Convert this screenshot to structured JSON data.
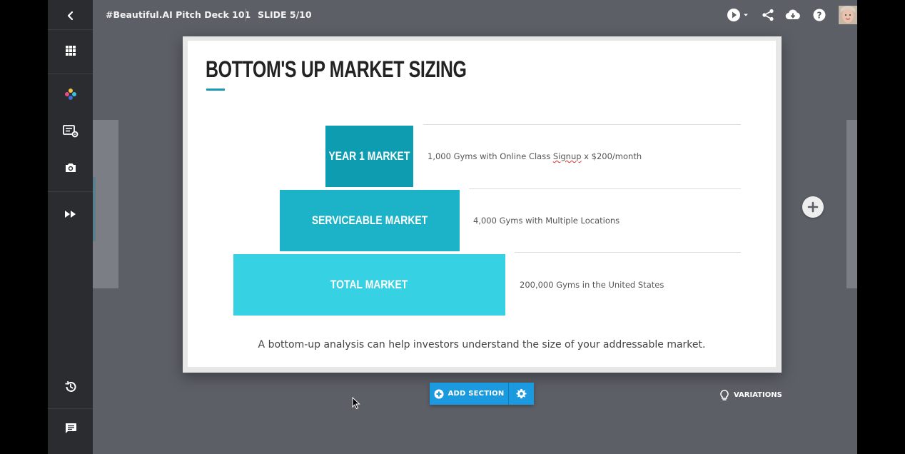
{
  "topbar": {
    "deck_title": "#Beautiful.AI Pitch Deck 101",
    "slide_indicator": "SLIDE 5/10"
  },
  "slide": {
    "title": "BOTTOM'S UP MARKET SIZING",
    "accent_color": "#1a9ab4",
    "tiers": [
      {
        "label": "YEAR 1 MARKET",
        "desc_before": "1,000 Gyms with Online Class ",
        "desc_marked": "Signup",
        "desc_after": " x $200/month",
        "color": "#0e9cb0"
      },
      {
        "label": "SERVICEABLE MARKET",
        "description": "4,000 Gyms with Multiple Locations",
        "color": "#1cb3c8"
      },
      {
        "label": "TOTAL MARKET",
        "description": "200,000 Gyms in the United States",
        "color": "#36d1e3"
      }
    ],
    "caption": "A bottom-up analysis can help investors understand the size of your addressable market."
  },
  "actions": {
    "add_section_label": "ADD SECTION",
    "variations_label": "VARIATIONS",
    "add_section_color": "#1b9ae0"
  },
  "icons": {
    "sidebar": [
      "back-arrow-icon",
      "grid-icon",
      "theme-dots-icon",
      "slide-settings-icon",
      "camera-icon",
      "fast-forward-icon",
      "history-icon",
      "comment-icon"
    ],
    "topbar": [
      "play-icon",
      "share-icon",
      "download-icon",
      "help-icon",
      "user-avatar"
    ]
  }
}
